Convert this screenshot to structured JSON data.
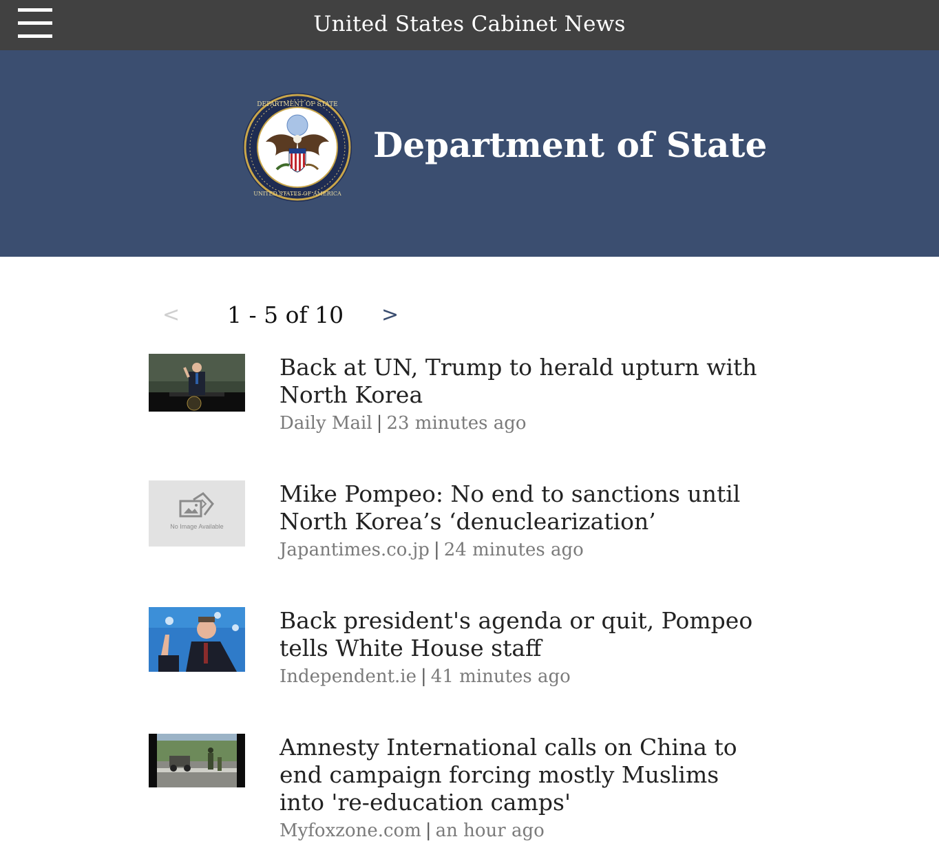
{
  "app": {
    "title": "United States Cabinet News",
    "menu_icon": "hamburger-menu-icon"
  },
  "hero": {
    "department": "Department of State",
    "seal_icon": "department-of-state-seal",
    "seal_text": "DEPARTMENT OF STATE UNITED STATES OF AMERICA",
    "background": "#3b4e70"
  },
  "pager": {
    "prev": "<",
    "range": "1 - 5 of 10",
    "next": ">"
  },
  "articles": [
    {
      "title": "Back at UN, Trump to herald upturn with North Korea",
      "source": "Daily Mail",
      "separator": "|",
      "time": "23 minutes ago",
      "thumb": "un-podium-photo"
    },
    {
      "title": "Mike Pompeo: No end to sanctions until North Korea’s ‘denuclearization’",
      "source": "Japantimes.co.jp",
      "separator": "|",
      "time": "24 minutes ago",
      "thumb": "no-image-placeholder",
      "thumb_caption": "No Image Available"
    },
    {
      "title": "Back president's agenda or quit, Pompeo tells White House staff",
      "source": "Independent.ie",
      "separator": "|",
      "time": "41 minutes ago",
      "thumb": "pompeo-speaking-photo"
    },
    {
      "title": "Amnesty International calls on China to end campaign forcing mostly Muslims into 're-education camps'",
      "source": "Myfoxzone.com",
      "separator": "|",
      "time": "an hour ago",
      "thumb": "patrol-street-photo"
    }
  ]
}
